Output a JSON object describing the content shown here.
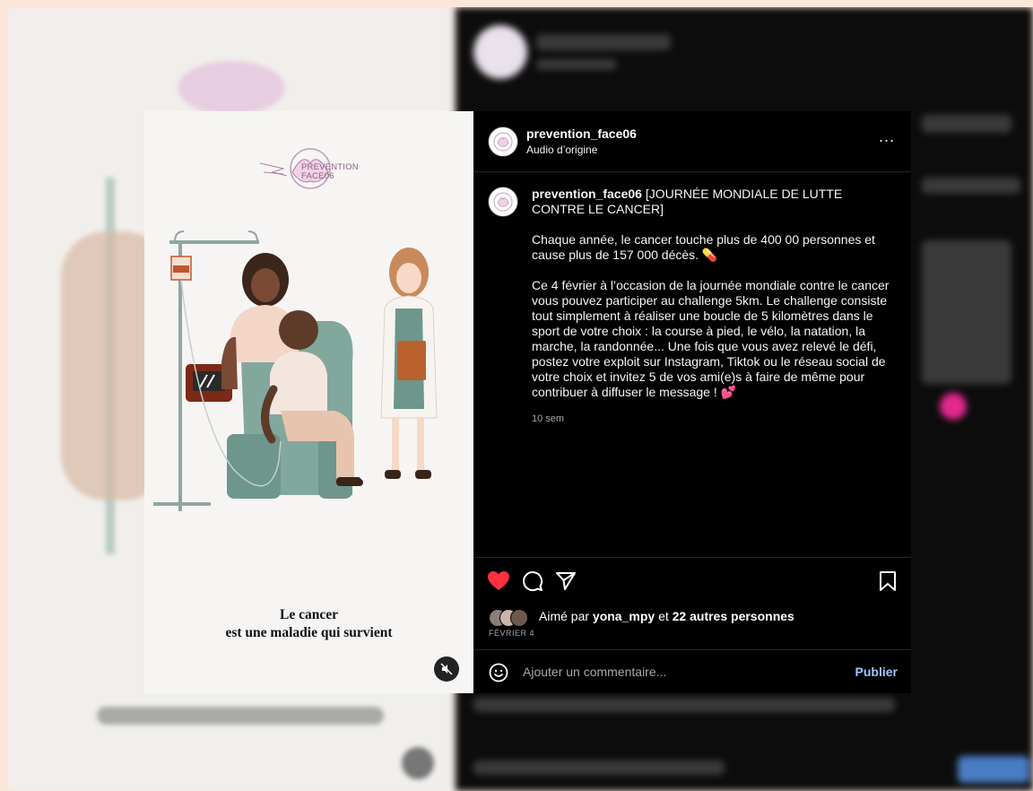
{
  "post": {
    "username": "prevention_face06",
    "audio": "Audio d’origine",
    "more_label": "...",
    "caption_title": "[JOURNÉE MONDIALE DE LUTTE CONTRE LE CANCER]",
    "caption_p1": "Chaque année, le cancer touche plus de 400 00 personnes et cause plus de 157 000 décès. 💊",
    "caption_p2": "Ce 4 février à l’occasion de la journée mondiale contre le cancer vous pouvez participer au challenge 5km. Le challenge consiste tout simplement à réaliser une boucle de 5 kilomètres dans le sport de votre choix : la course à pied, le vélo, la natation, la marche, la randonnée...  Une fois que vous avez relevé le défi, postez votre exploit sur Instagram, Tiktok ou le réseau social de votre choix et invitez 5 de vos ami(e)s à faire de même pour contribuer à diffuser le message ! 💕",
    "time_ago": "10 sem",
    "likes_prefix": "Aimé par",
    "likes_user": "yona_mpy",
    "likes_and": "et",
    "likes_rest": "22 autres personnes",
    "date": "FÉVRIER 4",
    "comment_placeholder": "Ajouter un commentaire...",
    "publish_label": "Publier"
  },
  "media": {
    "brand_line1": "PREVENTION",
    "brand_line2": "FACE06",
    "caption_line1": "Le cancer",
    "caption_line2": "est une maladie qui survient"
  },
  "colors": {
    "like_red": "#ff3040",
    "publish_blue": "#9ec5ff",
    "brand_purple": "#8d5b86"
  },
  "icons": [
    "heart-icon",
    "comment-icon",
    "share-icon",
    "bookmark-icon",
    "emoji-icon",
    "mute-icon",
    "more-icon"
  ]
}
